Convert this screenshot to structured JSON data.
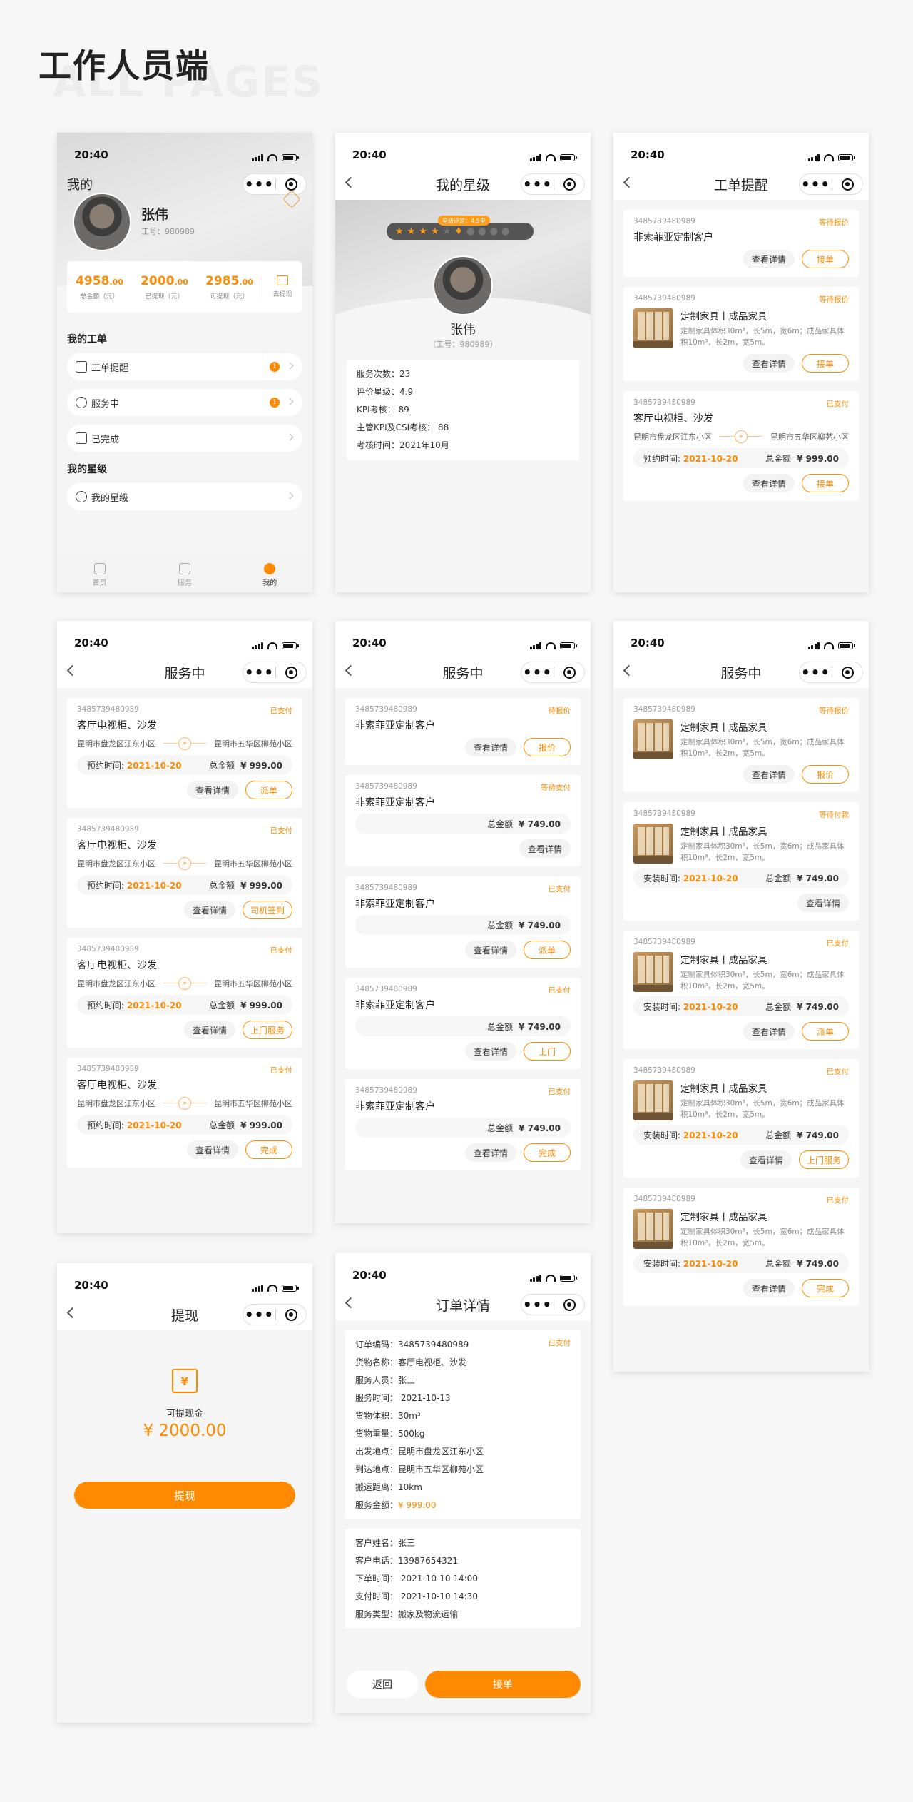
{
  "page": {
    "title": "工作人员端",
    "subtitle": "ALL PAGES"
  },
  "status_time": "20:40",
  "labels": {
    "view": "查看详情",
    "total": "总金额",
    "price": "¥ 999.00",
    "price2": "¥ 749.00",
    "appoint": "预约时间:",
    "install": "安装时间:",
    "date": "2021-10-20",
    "from": "昆明市盘龙区江东小区",
    "to": "昆明市五华区柳苑小区",
    "cargo": "客厅电视柜、沙发",
    "customer": "非索菲亚定制客户",
    "goods_name": "定制家具丨成品家具",
    "goods_desc": "定制家具体积30m³，长5m，宽6m；成品家具体积10m³，长2m，宽5m。",
    "oid": "3485739480989",
    "arrow": "»"
  },
  "profile": {
    "nav_title": "我的",
    "name": "张伟",
    "job_no": "工号：980989",
    "stats": [
      {
        "value": "4958",
        "decimals": ".00",
        "label": "总金额（元）"
      },
      {
        "value": "2000",
        "decimals": ".00",
        "label": "已提现（元）"
      },
      {
        "value": "2985",
        "decimals": ".00",
        "label": "可提现（元）"
      }
    ],
    "withdraw_label": "去提现",
    "section_orders": "我的工单",
    "rows": [
      {
        "label": "工单提醒",
        "badge": "1"
      },
      {
        "label": "服务中",
        "badge": "1"
      },
      {
        "label": "已完成"
      }
    ],
    "section_level": "我的星级",
    "level_row": "我的星级",
    "tabs": [
      "首页",
      "服务",
      "我的"
    ]
  },
  "level": {
    "nav_title": "我的星级",
    "badge": "星级评定：4.5星",
    "name": "张伟",
    "job_no": "（工号：980989）",
    "info": [
      "服务次数：23",
      "评价星级：4.9",
      "KPI考核： 89",
      "主管KPI及CSI考核： 88",
      "考核时间：2021年10月"
    ]
  },
  "remind": {
    "nav_title": "工单提醒",
    "status1": "等待报价",
    "status2": "等待报价",
    "status3": "已支付",
    "btn_accept": "接单"
  },
  "service_a": {
    "nav_title": "服务中",
    "status": "已支付",
    "buttons": [
      "派单",
      "司机签到",
      "上门服务",
      "完成"
    ]
  },
  "service_b": {
    "nav_title": "服务中",
    "statuses": [
      "待报价",
      "等待支付",
      "已支付",
      "已支付",
      "已支付"
    ],
    "buttons": [
      "报价",
      "",
      "派单",
      "上门",
      "完成"
    ]
  },
  "service_c": {
    "nav_title": "服务中",
    "statuses": [
      "等待报价",
      "等待付款",
      "已支付",
      "已支付",
      "已支付"
    ],
    "buttons": [
      "报价",
      "",
      "派单",
      "上门服务",
      "完成"
    ]
  },
  "withdraw": {
    "nav_title": "提现",
    "label": "可提现金",
    "amount": "¥ 2000.00",
    "button": "提现",
    "icon": "¥"
  },
  "detail": {
    "nav_title": "订单详情",
    "status": "已支付",
    "info1": [
      "订单编码：3485739480989",
      "货物名称：客厅电视柜、沙发",
      "服务人员：张三",
      "服务时间： 2021-10-13",
      "货物体积：30m³",
      "货物重量：500kg",
      "出发地点：昆明市盘龙区江东小区",
      "到达地点：昆明市五华区柳苑小区",
      "搬运距离：10km"
    ],
    "amount_label": "服务金额：",
    "amount": "¥ 999.00",
    "info2": [
      "客户姓名：张三",
      "客户电话：13987654321",
      "下单时间： 2021-10-10  14:00",
      "支付时间： 2021-10-10  14:30",
      "服务类型：搬家及物流运输"
    ],
    "back": "返回",
    "accept": "接单"
  },
  "colors": {
    "accent": "#ff8a00",
    "bg": "#f5f5f5"
  }
}
